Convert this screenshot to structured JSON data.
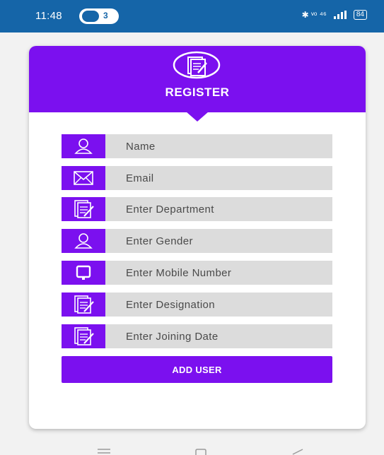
{
  "status_bar": {
    "time": "11:48",
    "notification_count": "3",
    "right_text": "✱ ᵛᵒ ⁴⁶",
    "battery": "84"
  },
  "header": {
    "title": "REGISTER",
    "icon": "edit-document-icon"
  },
  "fields": [
    {
      "placeholder": "Name",
      "icon": "person-icon"
    },
    {
      "placeholder": "Email",
      "icon": "envelope-icon"
    },
    {
      "placeholder": "Enter Department",
      "icon": "edit-document-icon"
    },
    {
      "placeholder": "Enter Gender",
      "icon": "person-icon"
    },
    {
      "placeholder": "Enter Mobile Number",
      "icon": "tablet-icon"
    },
    {
      "placeholder": "Enter Designation",
      "icon": "edit-document-icon"
    },
    {
      "placeholder": "Enter Joining Date",
      "icon": "edit-document-icon"
    }
  ],
  "add_button_label": "ADD USER",
  "colors": {
    "accent": "#7b10ef",
    "status_bar": "#1565a8",
    "field_bg": "#dcdcdc"
  },
  "nav_bar": [
    "menu-icon",
    "home-icon",
    "back-icon"
  ]
}
